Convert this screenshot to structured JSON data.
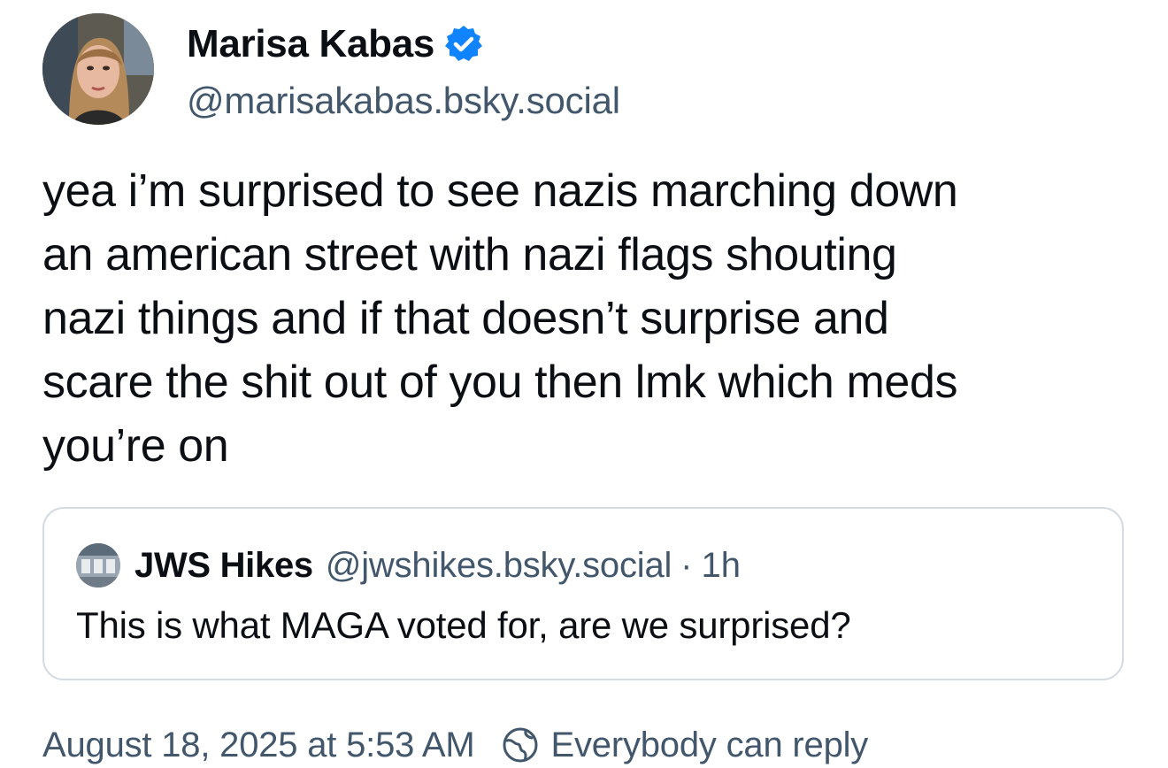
{
  "author": {
    "display_name": "Marisa Kabas",
    "handle": "@marisakabas.bsky.social",
    "verified": true,
    "avatar_icon": "profile-photo"
  },
  "post": {
    "text": "yea i’m surprised to see nazis marching down\nan american street with nazi flags shouting\nnazi things and if that doesn’t surprise and\nscare the shit out of you then lmk which meds\nyou’re on"
  },
  "quote": {
    "display_name": "JWS Hikes",
    "handle": "@jwshikes.bsky.social",
    "separator": "·",
    "time": "1h",
    "text": "This is what MAGA voted for, are we surprised?"
  },
  "footer": {
    "timestamp": "August 18, 2025 at 5:53 AM",
    "reply_setting": "Everybody can reply",
    "reply_icon": "globe-icon"
  },
  "colors": {
    "text_primary": "#0b0f14",
    "text_secondary": "#42576c",
    "verified_blue": "#1083fe",
    "border": "#d4dbe2"
  }
}
